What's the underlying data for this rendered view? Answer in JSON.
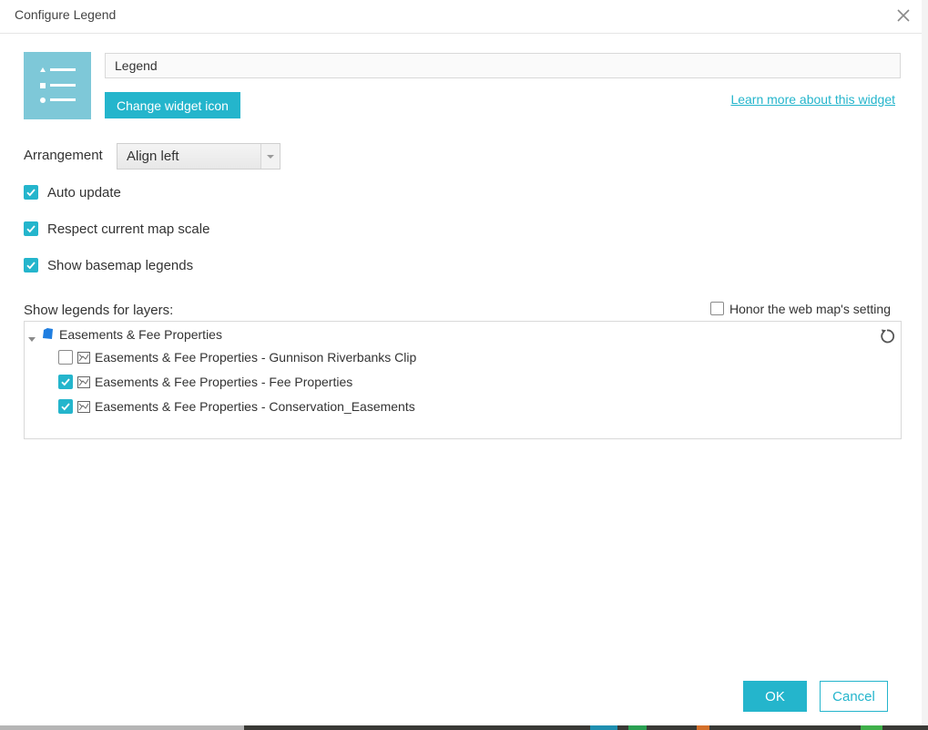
{
  "dialog": {
    "title": "Configure Legend",
    "close_icon": "close-icon"
  },
  "widget": {
    "icon": "legend-list-icon",
    "tile_color": "#7ec8d8",
    "name_value": "Legend",
    "change_icon_label": "Change widget icon",
    "learn_more_label": "Learn more about this widget"
  },
  "arrangement": {
    "label": "Arrangement",
    "selected": "Align left"
  },
  "options": [
    {
      "label": "Auto update",
      "checked": true
    },
    {
      "label": "Respect current map scale",
      "checked": true
    },
    {
      "label": "Show basemap legends",
      "checked": true
    }
  ],
  "layers": {
    "label": "Show legends for layers:",
    "honor_label": "Honor the web map's setting",
    "honor_checked": false,
    "group": {
      "label": "Easements & Fee Properties",
      "icon": "map-service-icon",
      "expanded": true
    },
    "items": [
      {
        "label": "Easements & Fee Properties - Gunnison Riverbanks Clip",
        "checked": false,
        "icon": "feature-layer-icon"
      },
      {
        "label": "Easements & Fee Properties - Fee Properties",
        "checked": true,
        "icon": "feature-layer-icon"
      },
      {
        "label": "Easements & Fee Properties - Conservation_Easements",
        "checked": true,
        "icon": "feature-layer-icon"
      }
    ],
    "refresh_icon": "refresh-icon"
  },
  "footer": {
    "ok_label": "OK",
    "cancel_label": "Cancel"
  },
  "colors": {
    "accent": "#24b5cc",
    "tile": "#7ec8d8",
    "border": "#d9d9d9",
    "text": "#333333"
  }
}
